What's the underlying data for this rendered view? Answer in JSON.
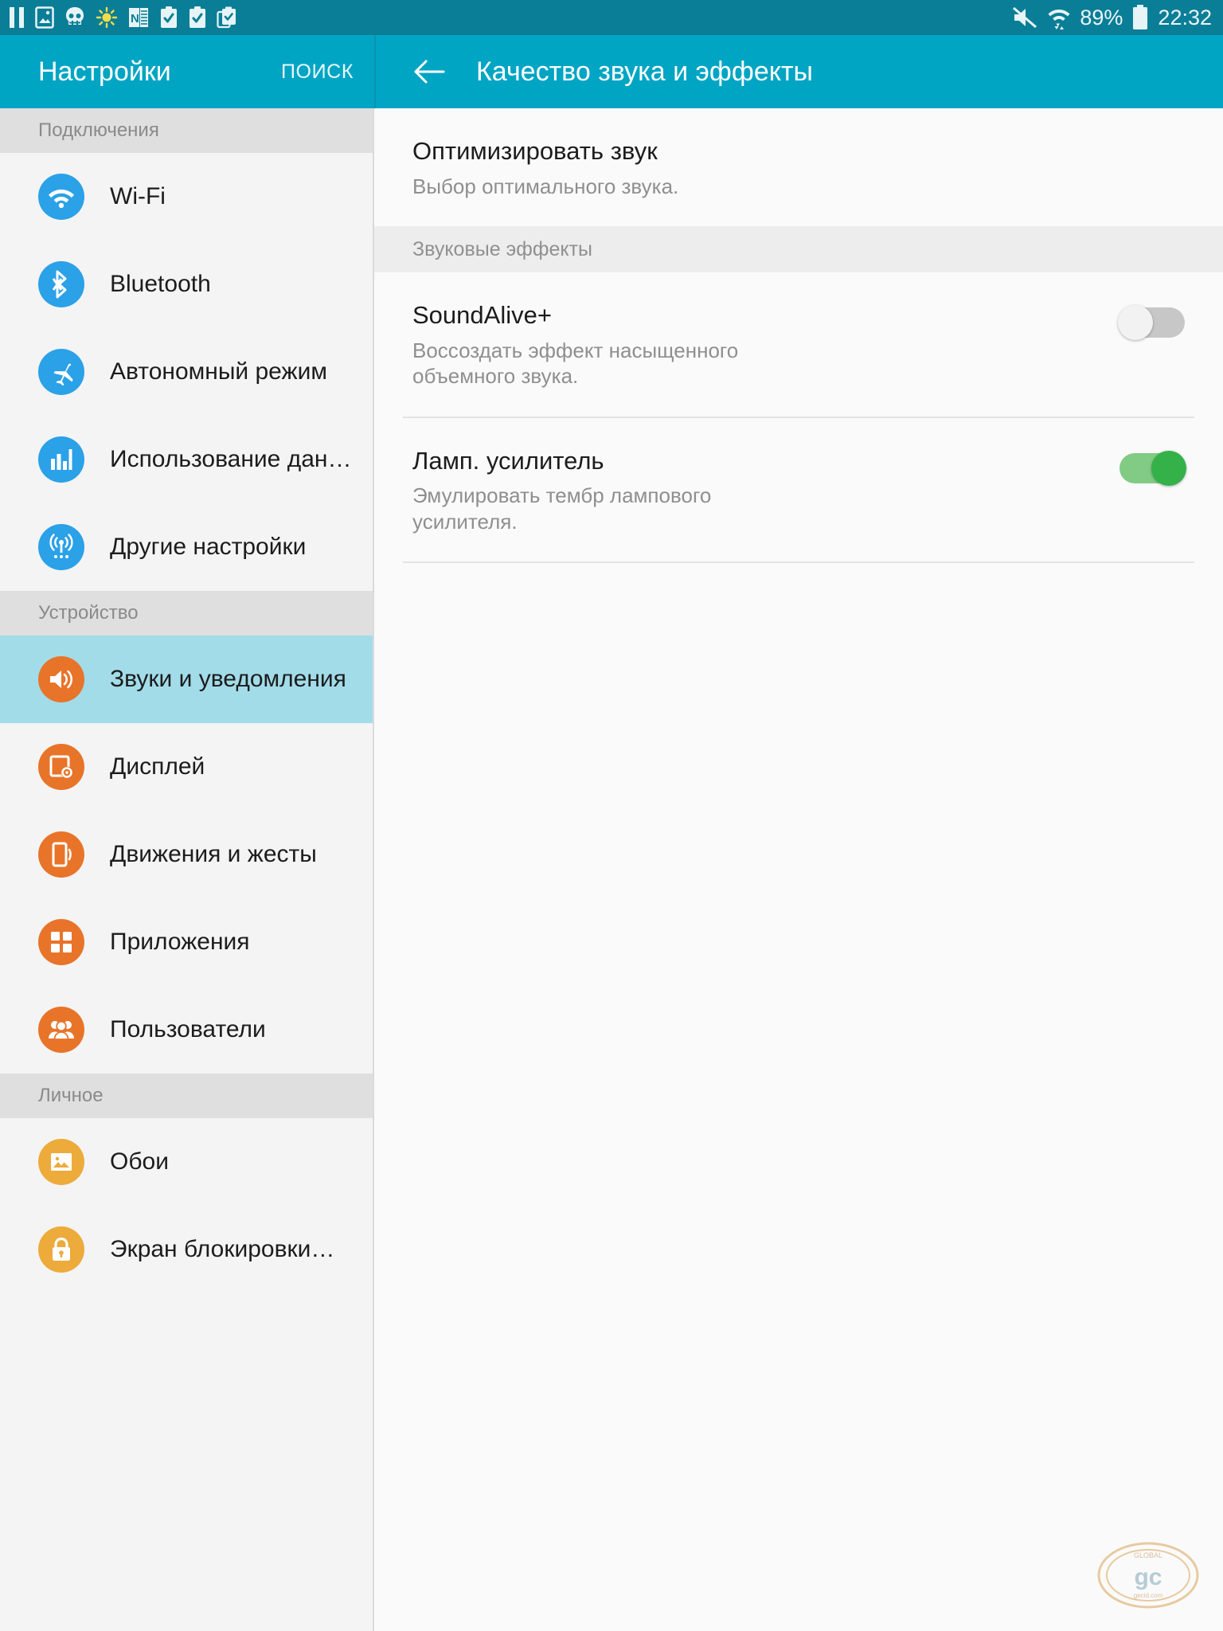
{
  "status_bar": {
    "notification_icons": [
      "pause-icon",
      "image-icon",
      "skull-icon",
      "brightness-icon",
      "onenote-icon",
      "clipboard-check-icon",
      "clipboard-check-icon",
      "clipboard-copy-icon"
    ],
    "mute_icon": "mute-icon",
    "wifi_icon": "wifi-transfer-icon",
    "battery_percent": "89%",
    "battery_icon": "battery-icon",
    "clock": "22:32"
  },
  "app_bar": {
    "title": "Настройки",
    "search_label": "ПОИСК",
    "back_icon": "back-arrow-icon",
    "detail_title": "Качество звука и эффекты"
  },
  "sidebar": {
    "sections": [
      {
        "header": "Подключения",
        "items": [
          {
            "label": "Wi-Fi",
            "icon": "wifi-icon",
            "color": "#2BA1E8",
            "selected": false
          },
          {
            "label": "Bluetooth",
            "icon": "bluetooth-icon",
            "color": "#2BA1E8",
            "selected": false
          },
          {
            "label": "Автономный режим",
            "icon": "airplane-icon",
            "color": "#2BA1E8",
            "selected": false
          },
          {
            "label": "Использование дан…",
            "icon": "data-usage-icon",
            "color": "#2BA1E8",
            "selected": false
          },
          {
            "label": "Другие настройки",
            "icon": "broadcast-icon",
            "color": "#2BA1E8",
            "selected": false
          }
        ]
      },
      {
        "header": "Устройство",
        "items": [
          {
            "label": "Звуки и уведомления",
            "icon": "speaker-icon",
            "color": "#E8742A",
            "selected": true
          },
          {
            "label": "Дисплей",
            "icon": "display-settings-icon",
            "color": "#E8742A",
            "selected": false
          },
          {
            "label": "Движения и жесты",
            "icon": "motion-gesture-icon",
            "color": "#E8742A",
            "selected": false
          },
          {
            "label": "Приложения",
            "icon": "apps-grid-icon",
            "color": "#E8742A",
            "selected": false
          },
          {
            "label": "Пользователи",
            "icon": "users-icon",
            "color": "#E8742A",
            "selected": false
          }
        ]
      },
      {
        "header": "Личное",
        "items": [
          {
            "label": "Обои",
            "icon": "wallpaper-icon",
            "color": "#EDAB3C",
            "selected": false
          },
          {
            "label": "Экран блокировки…",
            "icon": "lock-icon",
            "color": "#EDAB3C",
            "selected": false
          }
        ]
      }
    ]
  },
  "detail": {
    "optimize": {
      "title": "Оптимизировать звук",
      "subtitle": "Выбор оптимального звука."
    },
    "effects_header": "Звуковые эффекты",
    "effects": [
      {
        "title": "SoundAlive+",
        "subtitle": "Воссоздать эффект насыщенного объемного звука.",
        "toggle_state": "off"
      },
      {
        "title": "Ламп. усилитель",
        "subtitle": "Эмулировать тембр лампового усилителя.",
        "toggle_state": "on"
      }
    ]
  },
  "colors": {
    "status_bar": "#0A7E96",
    "app_bar": "#00A5C4",
    "selected_row": "#A2DCE9",
    "toggle_on": "#35B14A",
    "toggle_off": "#C7C7C7"
  },
  "watermark": {
    "icon": "gecid-logo-icon"
  }
}
